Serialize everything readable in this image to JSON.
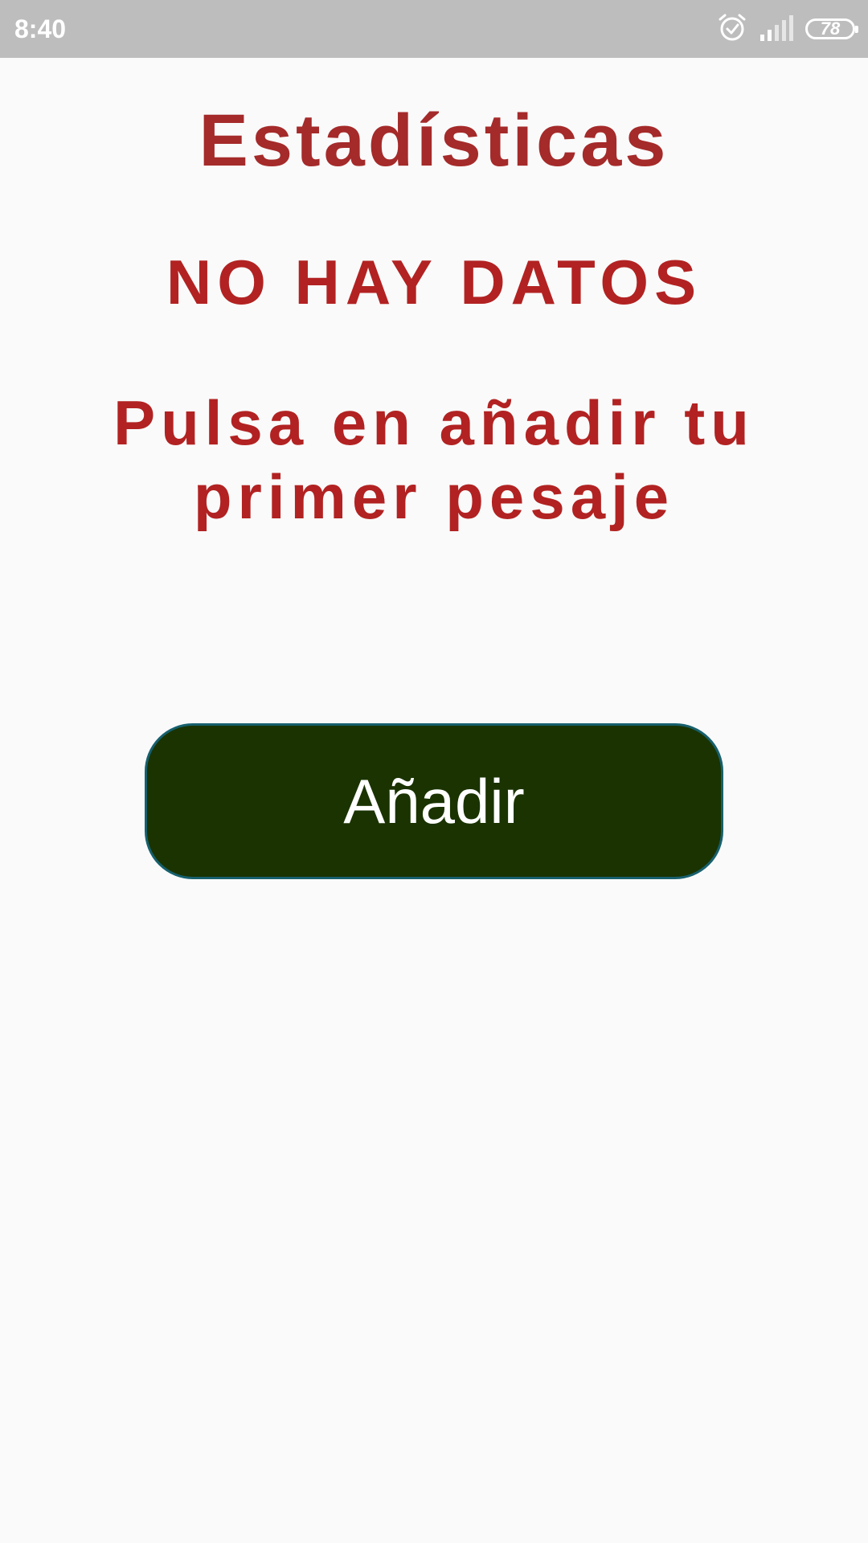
{
  "status_bar": {
    "time": "8:40",
    "battery_level": "78",
    "icons": [
      "alarm-icon",
      "signal-icon",
      "battery-icon"
    ]
  },
  "main": {
    "title": "Estadísticas",
    "empty_message": "NO HAY DATOS",
    "hint": "Pulsa en añadir tu primer pesaje",
    "add_button_label": "Añadir"
  },
  "colors": {
    "status_bar_bg": "#bdbdbd",
    "background": "#fafafa",
    "title": "#a52a2a",
    "message": "#b22222",
    "button_bg": "#1a3300",
    "button_border": "#17606e",
    "button_text": "#ffffff"
  }
}
